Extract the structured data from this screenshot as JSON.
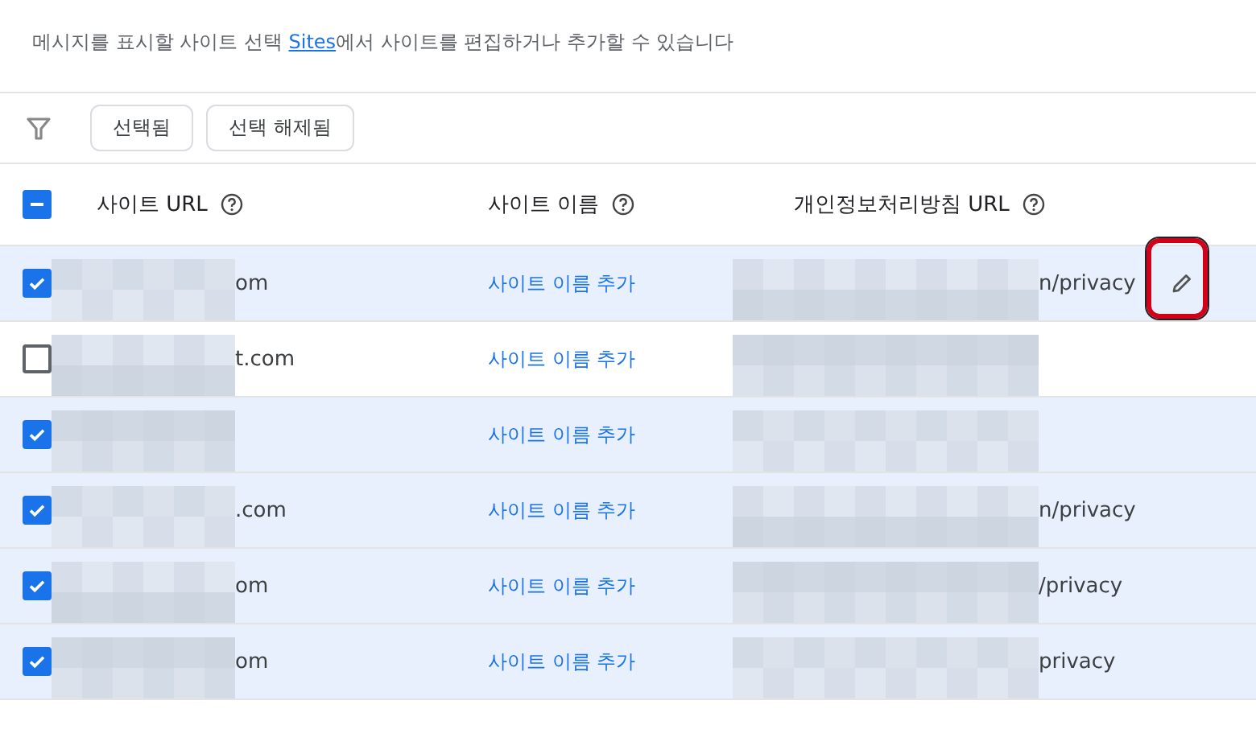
{
  "description": {
    "before": "메시지를 표시할 사이트 선택 ",
    "link": "Sites",
    "after": "에서 사이트를 편집하거나 추가할 수 있습니다"
  },
  "filters": [
    {
      "label": "선택됨"
    },
    {
      "label": "선택 해제됨"
    }
  ],
  "table": {
    "select_all": {
      "indeterminate": true
    },
    "columns": [
      {
        "label": "사이트 URL"
      },
      {
        "label": "사이트 이름"
      },
      {
        "label": "개인정보처리방침 URL"
      }
    ],
    "rows": [
      {
        "checked": true,
        "url": "om",
        "name": "사이트 이름 추가",
        "privacy": "n/privacy",
        "edit": {
          "highlighted": true
        }
      },
      {
        "checked": false,
        "url": "t.com",
        "name": "사이트 이름 추가",
        "privacy": ""
      },
      {
        "checked": true,
        "url": "",
        "name": "사이트 이름 추가",
        "privacy": ""
      },
      {
        "checked": true,
        "url": ".com",
        "name": "사이트 이름 추가",
        "privacy": "n/privacy"
      },
      {
        "checked": true,
        "url": "om",
        "name": "사이트 이름 추가",
        "privacy": "/privacy"
      },
      {
        "checked": true,
        "url": "om",
        "name": "사이트 이름 추가",
        "privacy": "privacy"
      }
    ]
  }
}
